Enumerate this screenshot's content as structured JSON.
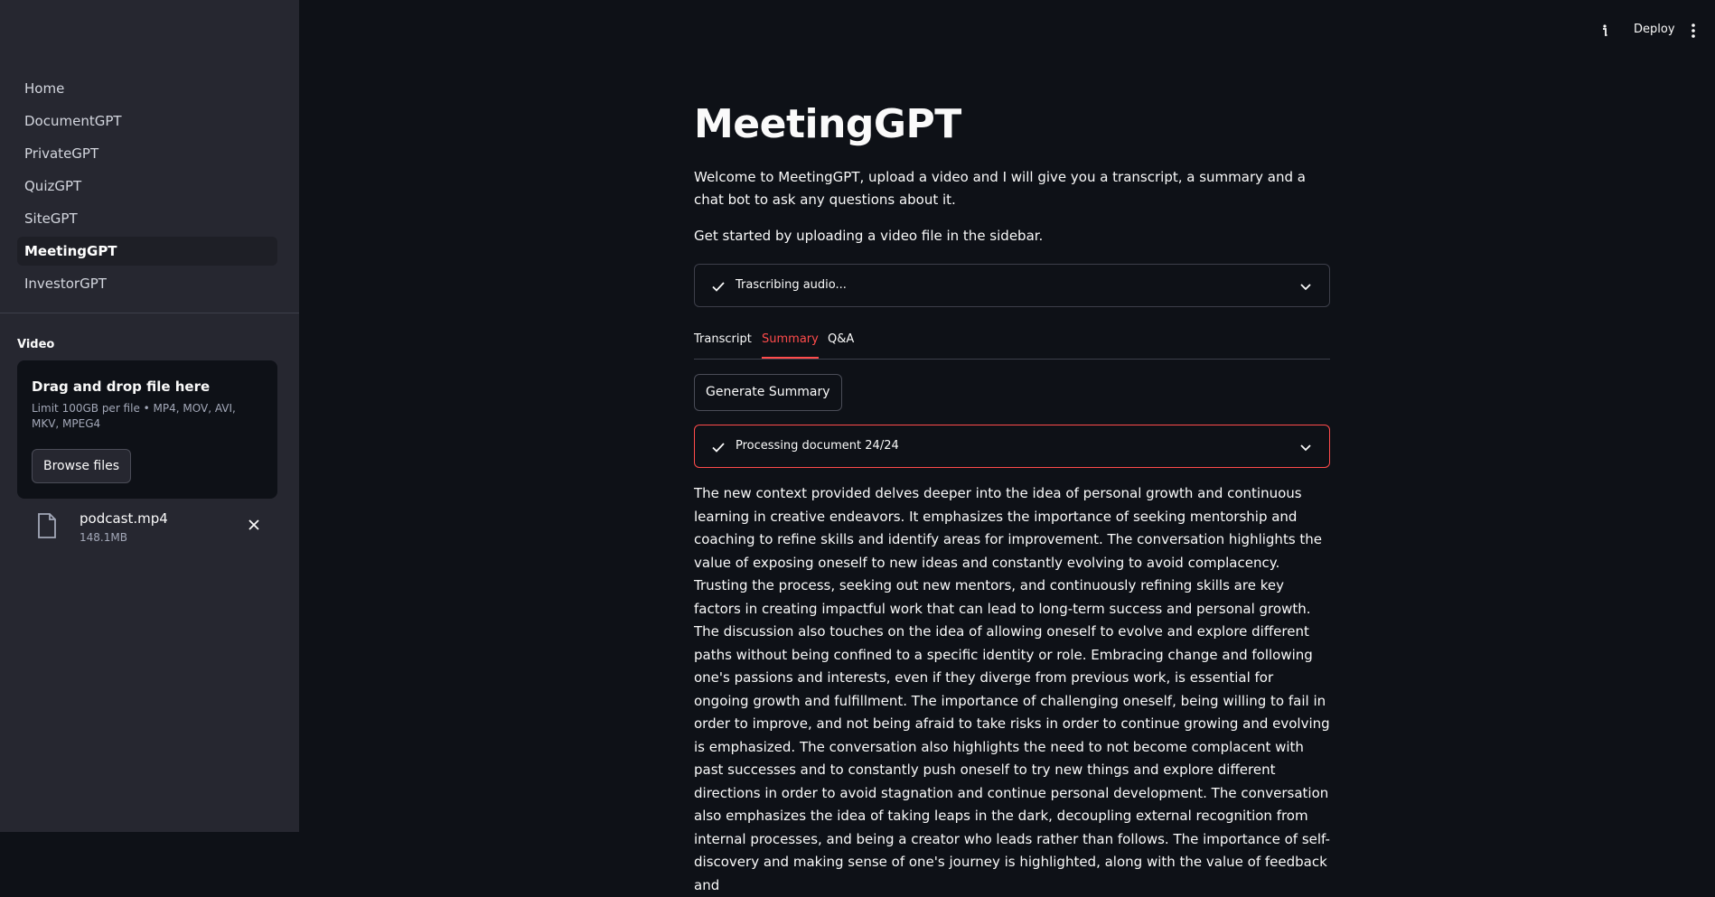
{
  "sidebar": {
    "nav_items": [
      {
        "label": "Home"
      },
      {
        "label": "DocumentGPT"
      },
      {
        "label": "PrivateGPT"
      },
      {
        "label": "QuizGPT"
      },
      {
        "label": "SiteGPT"
      },
      {
        "label": "MeetingGPT",
        "active": true
      },
      {
        "label": "InvestorGPT"
      }
    ],
    "video_label": "Video",
    "uploader": {
      "title": "Drag and drop file here",
      "limit": "Limit 100GB per file • MP4, MOV, AVI, MKV, MPEG4",
      "browse_label": "Browse files"
    },
    "file": {
      "name": "podcast.mp4",
      "size": "148.1MB",
      "icon": "file-icon"
    }
  },
  "topbar": {
    "deploy_label": "Deploy"
  },
  "main": {
    "title": "MeetingGPT",
    "intro": "Welcome to MeetingGPT, upload a video and I will give you a transcript, a summary and a chat bot to ask any questions about it.",
    "intro2": "Get started by uploading a video file in the sidebar.",
    "status_transcribe": "Trascribing audio...",
    "tabs": [
      {
        "label": "Transcript"
      },
      {
        "label": "Summary",
        "active": true
      },
      {
        "label": "Q&A"
      }
    ],
    "generate_label": "Generate Summary",
    "status_processing": "Processing document 24/24",
    "summary": "The new context provided delves deeper into the idea of personal growth and continuous learning in creative endeavors. It emphasizes the importance of seeking mentorship and coaching to refine skills and identify areas for improvement. The conversation highlights the value of exposing oneself to new ideas and constantly evolving to avoid complacency. Trusting the process, seeking out new mentors, and continuously refining skills are key factors in creating impactful work that can lead to long-term success and personal growth. The discussion also touches on the idea of allowing oneself to evolve and explore different paths without being confined to a specific identity or role. Embracing change and following one's passions and interests, even if they diverge from previous work, is essential for ongoing growth and fulfillment. The importance of challenging oneself, being willing to fail in order to improve, and not being afraid to take risks in order to continue growing and evolving is emphasized. The conversation also highlights the need to not become complacent with past successes and to constantly push oneself to try new things and explore different directions in order to avoid stagnation and continue personal development. The conversation also emphasizes the idea of taking leaps in the dark, decoupling external recognition from internal processes, and being a creator who leads rather than follows. The importance of self-discovery and making sense of one's journey is highlighted, along with the value of feedback and"
  },
  "colors": {
    "background": "#0e1117",
    "sidebar": "#262730",
    "accent": "#ff4b4b",
    "text": "#fafafa"
  }
}
